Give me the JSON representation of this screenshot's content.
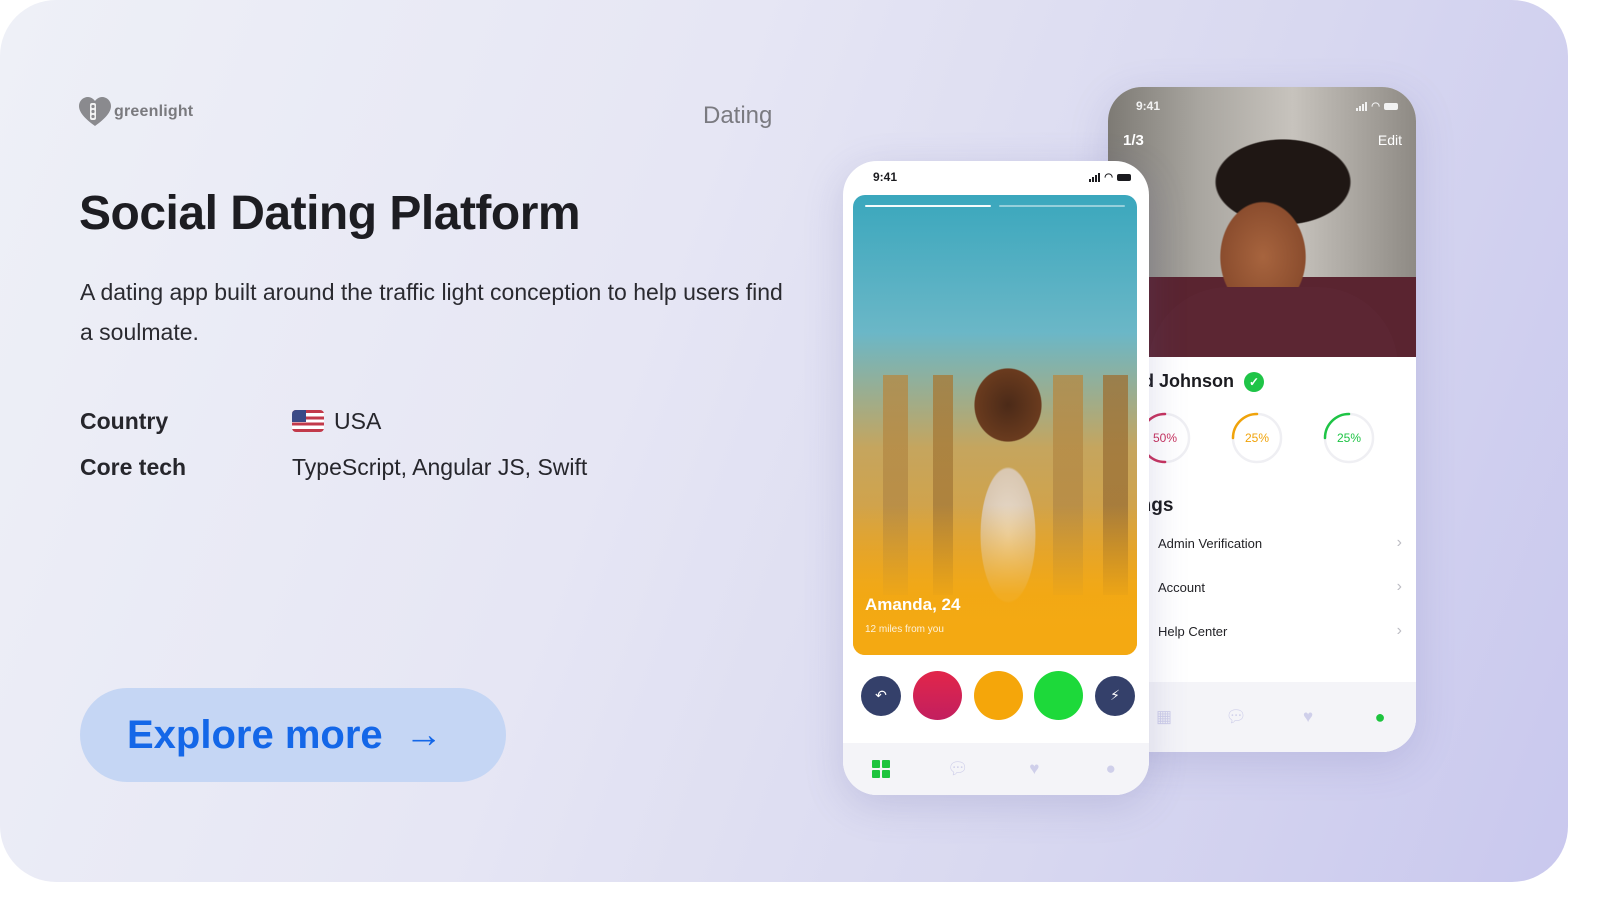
{
  "brand": {
    "name": "greenlight"
  },
  "category": "Dating",
  "title": "Social Dating Platform",
  "description": "A dating app built around the traffic light conception to help users find a soulmate.",
  "meta": {
    "country_label": "Country",
    "country_value": "USA",
    "country_flag": "us-flag-icon",
    "tech_label": "Core tech",
    "tech_value": "TypeScript, Angular JS, Swift"
  },
  "cta": {
    "label": "Explore more",
    "arrow": "→"
  },
  "colors": {
    "accent": "#1467e8",
    "cta_bg": "#c5d6f4",
    "red": "#e2264a",
    "yellow": "#f5a60a",
    "green": "#1dd93a"
  },
  "front_phone": {
    "time": "9:41",
    "story_progress": {
      "total": 2,
      "active": 1
    },
    "profile_name": "Amanda, 24",
    "distance": "12 miles from you",
    "actions": [
      "undo-icon",
      "red-light",
      "yellow-light",
      "green-light",
      "boost-icon"
    ],
    "tabs": [
      "grid-icon",
      "chat-icon",
      "heart-icon",
      "user-icon"
    ],
    "active_tab": "grid-icon"
  },
  "back_phone": {
    "time": "9:41",
    "photo_counter": "1/3",
    "edit_label": "Edit",
    "profile_name": "vid Johnson",
    "verified": true,
    "stats": [
      {
        "label": "50%",
        "value": 50,
        "color": "#c8325e"
      },
      {
        "label": "25%",
        "value": 25,
        "color": "#f0a30a"
      },
      {
        "label": "25%",
        "value": 25,
        "color": "#1ec445"
      }
    ],
    "settings_title": "tings",
    "settings": [
      {
        "label": "Admin Verification"
      },
      {
        "label": "Account"
      },
      {
        "label": "Help Center"
      }
    ],
    "tabs": [
      "grid-icon",
      "chat-icon",
      "heart-icon",
      "user-icon"
    ],
    "active_tab": "user-icon"
  }
}
